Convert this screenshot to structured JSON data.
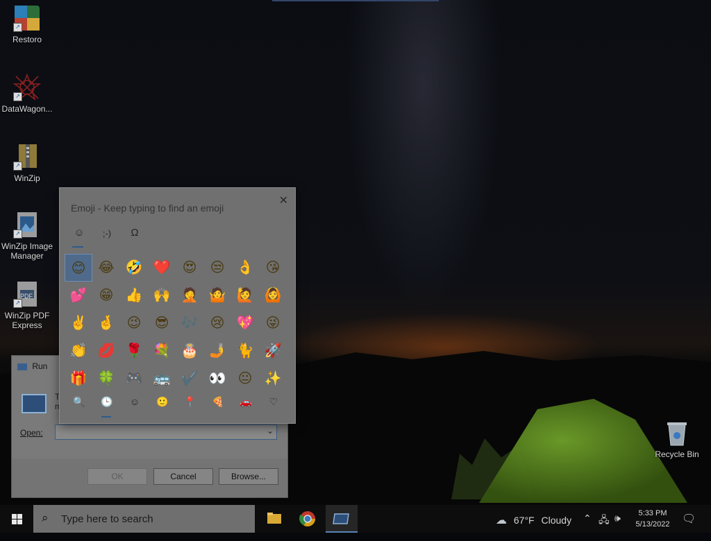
{
  "desktop": {
    "icons": [
      {
        "label": "Restoro",
        "icon": "restoro-icon"
      },
      {
        "label": "DataWagon...",
        "icon": "datawagon-icon"
      },
      {
        "label": "WinZip",
        "icon": "winzip-icon"
      },
      {
        "label": "WinZip Image Manager",
        "icon": "winzip-image-manager-icon"
      },
      {
        "label": "WinZip PDF Express",
        "icon": "winzip-pdf-express-icon"
      }
    ],
    "recycle_bin": "Recycle Bin",
    "pdf_badge": "PDF"
  },
  "emoji_panel": {
    "title": "Emoji - Keep typing to find an emoji",
    "close": "✕",
    "tabs": [
      "☺",
      ";-)",
      "Ω"
    ],
    "emojis": [
      "😊",
      "😂",
      "🤣",
      "❤️",
      "😍",
      "😒",
      "👌",
      "😘",
      "💕",
      "😁",
      "👍",
      "🙌",
      "🤦",
      "🤷",
      "🙋",
      "🙆",
      "✌️",
      "🤞",
      "😉",
      "😎",
      "🎶",
      "😢",
      "💖",
      "😜",
      "👏",
      "💋",
      "🌹",
      "💐",
      "🎂",
      "🤳",
      "🐈",
      "🚀",
      "🎁",
      "🍀",
      "🎮",
      "🚌",
      "✔️",
      "👀",
      "😐",
      "✨"
    ],
    "bottom_tabs": [
      "🔍",
      "🕒",
      "☺",
      "🙂",
      "📍",
      "🍕",
      "🚗",
      "♡"
    ]
  },
  "run_dialog": {
    "title": "Run",
    "description": "T\nm",
    "open_label": "Open:",
    "input_value": "",
    "ok": "OK",
    "cancel": "Cancel",
    "browse": "Browse..."
  },
  "taskbar": {
    "search_placeholder": "Type here to search",
    "weather_temp": "67°F",
    "weather_text": "Cloudy",
    "time": "5:33 PM",
    "date": "5/13/2022"
  }
}
